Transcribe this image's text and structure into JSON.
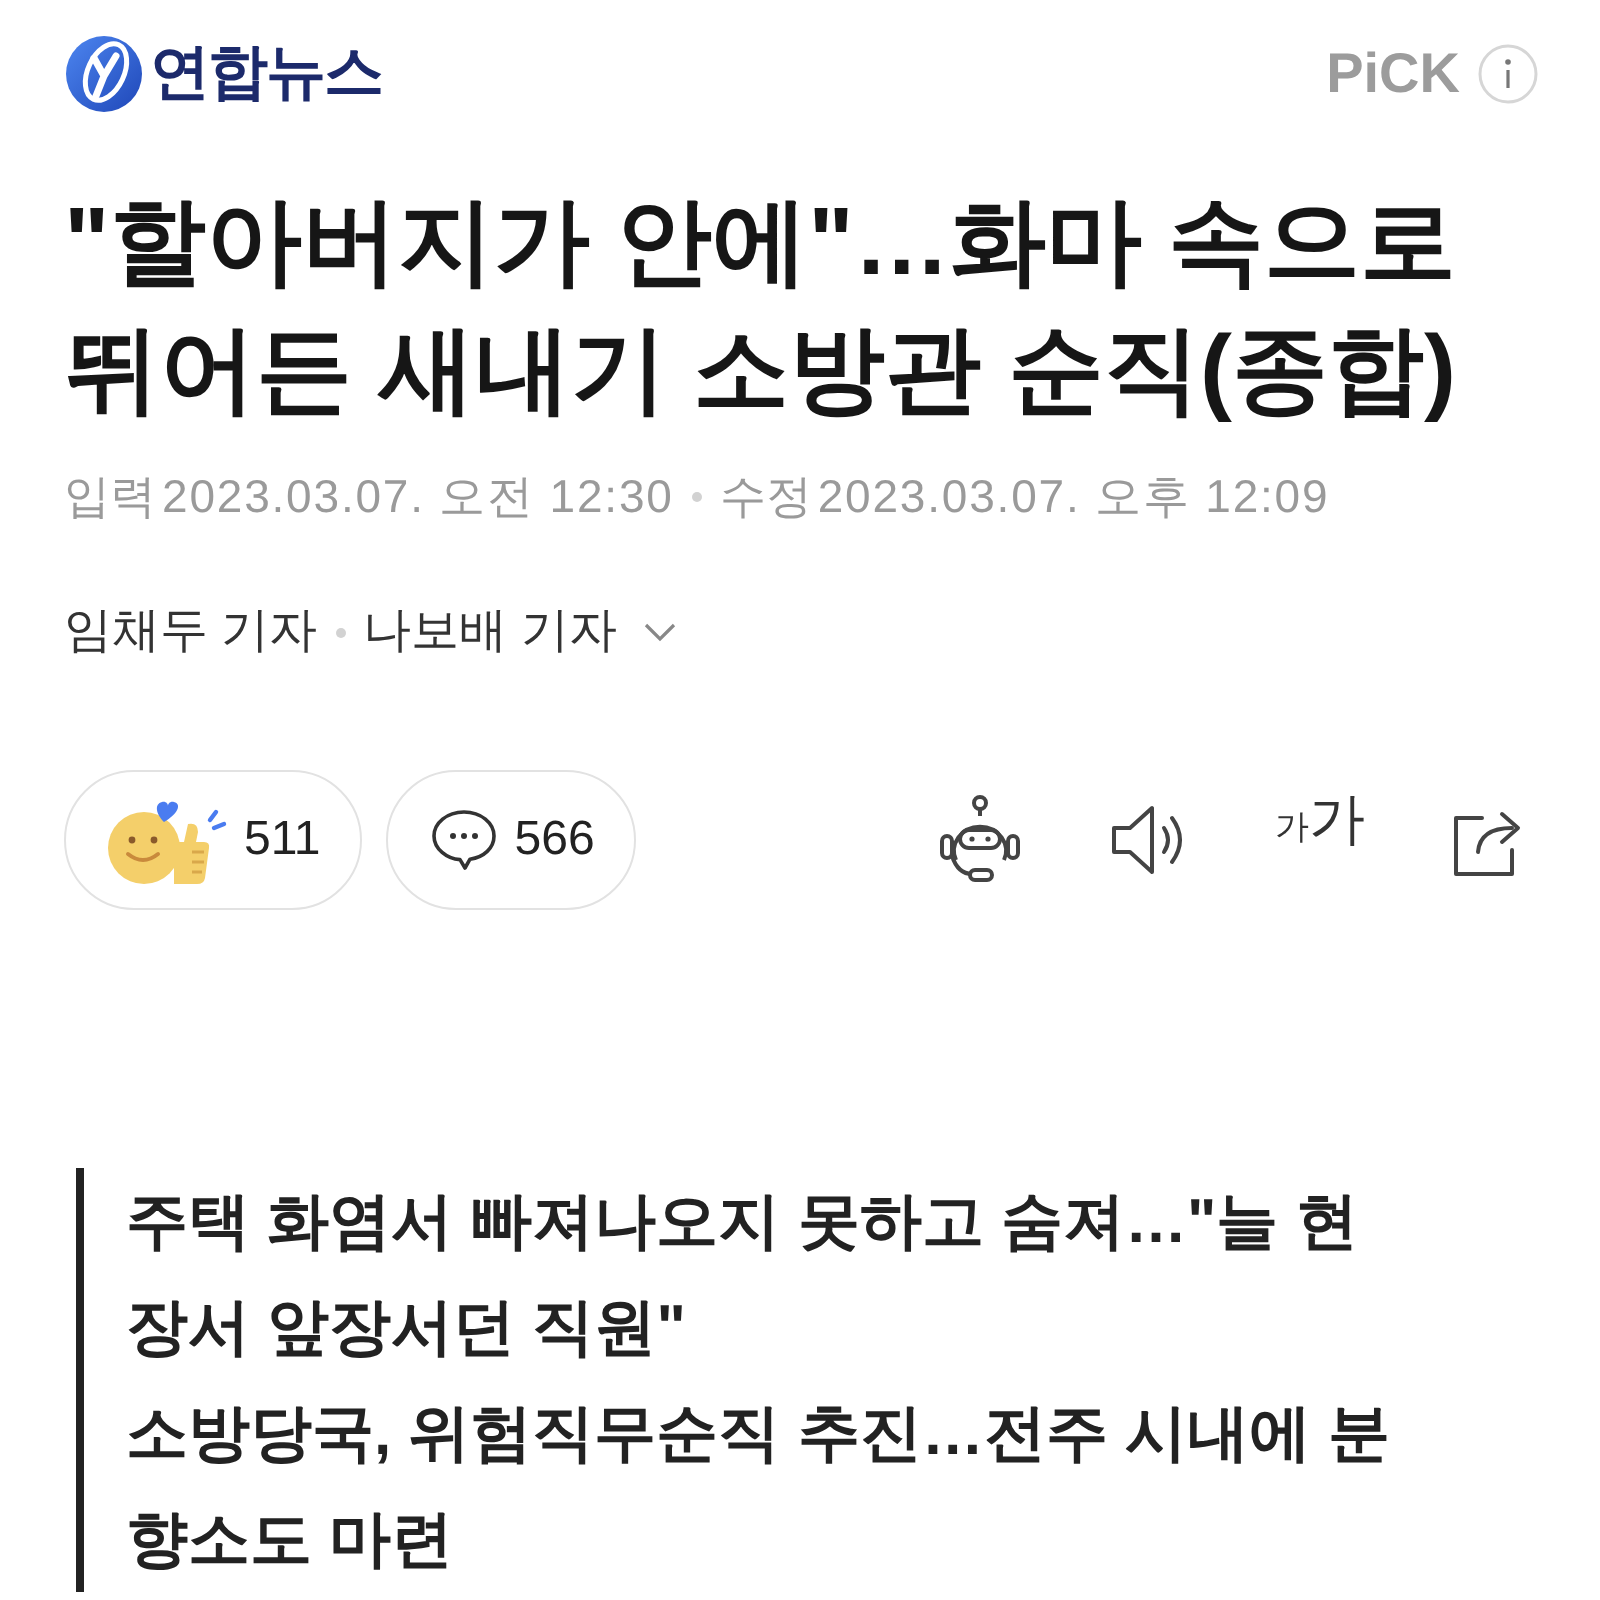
{
  "header": {
    "logo_text": "연합뉴스",
    "badge": "PiCK"
  },
  "article": {
    "title": "\"할아버지가 안에\"…화마 속으로 뛰어든 새내기 소방관 순직(종합)",
    "timestamps": [
      {
        "label": "입력",
        "value": "2023.03.07. 오전 12:30"
      },
      {
        "label": "수정",
        "value": "2023.03.07. 오후 12:09"
      }
    ],
    "reporters": {
      "names": [
        "임채두 기자",
        "나보배 기자"
      ],
      "expanded": false
    }
  },
  "actions": [
    {
      "kind": "reaction",
      "count": "511"
    },
    {
      "kind": "comment",
      "count": "566"
    }
  ],
  "tools": [
    {
      "kind": "summary"
    },
    {
      "kind": "listen"
    },
    {
      "kind": "font_size",
      "small": "가",
      "large": "가"
    },
    {
      "kind": "share"
    }
  ],
  "subheadings": [
    "주택 화염서 빠져나오지 못하고 숨져…\"늘 현장서 앞장서던 직원\"",
    "소방당국, 위험직무순직 추진…전주 시내에 분향소도 마련"
  ]
}
